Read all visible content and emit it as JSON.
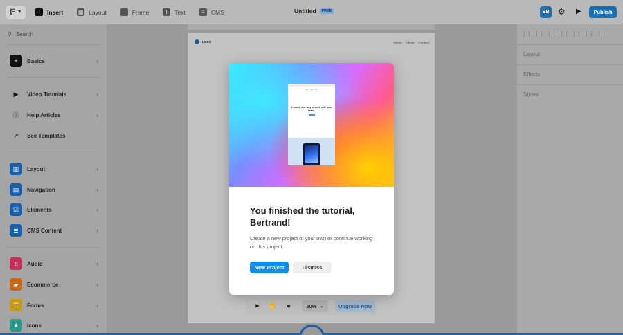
{
  "toolbar": {
    "tools": [
      {
        "label": "Insert",
        "icon": "plus-icon"
      },
      {
        "label": "Layout",
        "icon": "layout-icon"
      },
      {
        "label": "Frame",
        "icon": "frame-icon"
      },
      {
        "label": "Text",
        "icon": "text-icon"
      },
      {
        "label": "CMS",
        "icon": "cms-icon"
      }
    ],
    "doc_title": "Untitled",
    "plan_badge": "FREE",
    "avatar": "BB",
    "publish": "Publish"
  },
  "sidebar": {
    "search_placeholder": "Search",
    "items": [
      {
        "label": "Basics",
        "icon": "plus-icon",
        "color": "#111111"
      },
      {
        "label": "Video Tutorials",
        "icon": "play-icon",
        "color": "#a5a5a5"
      },
      {
        "label": "Help Articles",
        "icon": "info-icon",
        "color": "#a5a5a5"
      },
      {
        "label": "See Templates",
        "icon": "arrow-up-right-icon",
        "color": "#a5a5a5"
      },
      {
        "label": "Layout",
        "icon": "layout-icon",
        "color": "#1a5fa8"
      },
      {
        "label": "Navigation",
        "icon": "navigation-icon",
        "color": "#1a5fa8"
      },
      {
        "label": "Elements",
        "icon": "checkbox-icon",
        "color": "#1a5fa8"
      },
      {
        "label": "CMS Content",
        "icon": "database-icon",
        "color": "#1a5fa8"
      },
      {
        "label": "Audio",
        "icon": "music-icon",
        "color": "#c2305a"
      },
      {
        "label": "Ecommerce",
        "icon": "cart-icon",
        "color": "#c46a1a"
      },
      {
        "label": "Forms",
        "icon": "form-icon",
        "color": "#c89a12"
      },
      {
        "label": "Icons",
        "icon": "star-icon",
        "color": "#2a9a8a"
      }
    ]
  },
  "canvas": {
    "logo": "LOGO",
    "nav": [
      "Home",
      "About",
      "Contact"
    ]
  },
  "right_panel": {
    "sections": [
      "Layout",
      "Effects",
      "Styles"
    ]
  },
  "bottom_bar": {
    "zoom": "50%",
    "upgrade": "Upgrade Now"
  },
  "modal": {
    "preview_headline": "A brand new way to work with your team.",
    "title": "You finished the tutorial, Bertrand!",
    "body": "Create a new project of your own or continue working on this project.",
    "primary": "New Project",
    "secondary": "Dismiss"
  }
}
